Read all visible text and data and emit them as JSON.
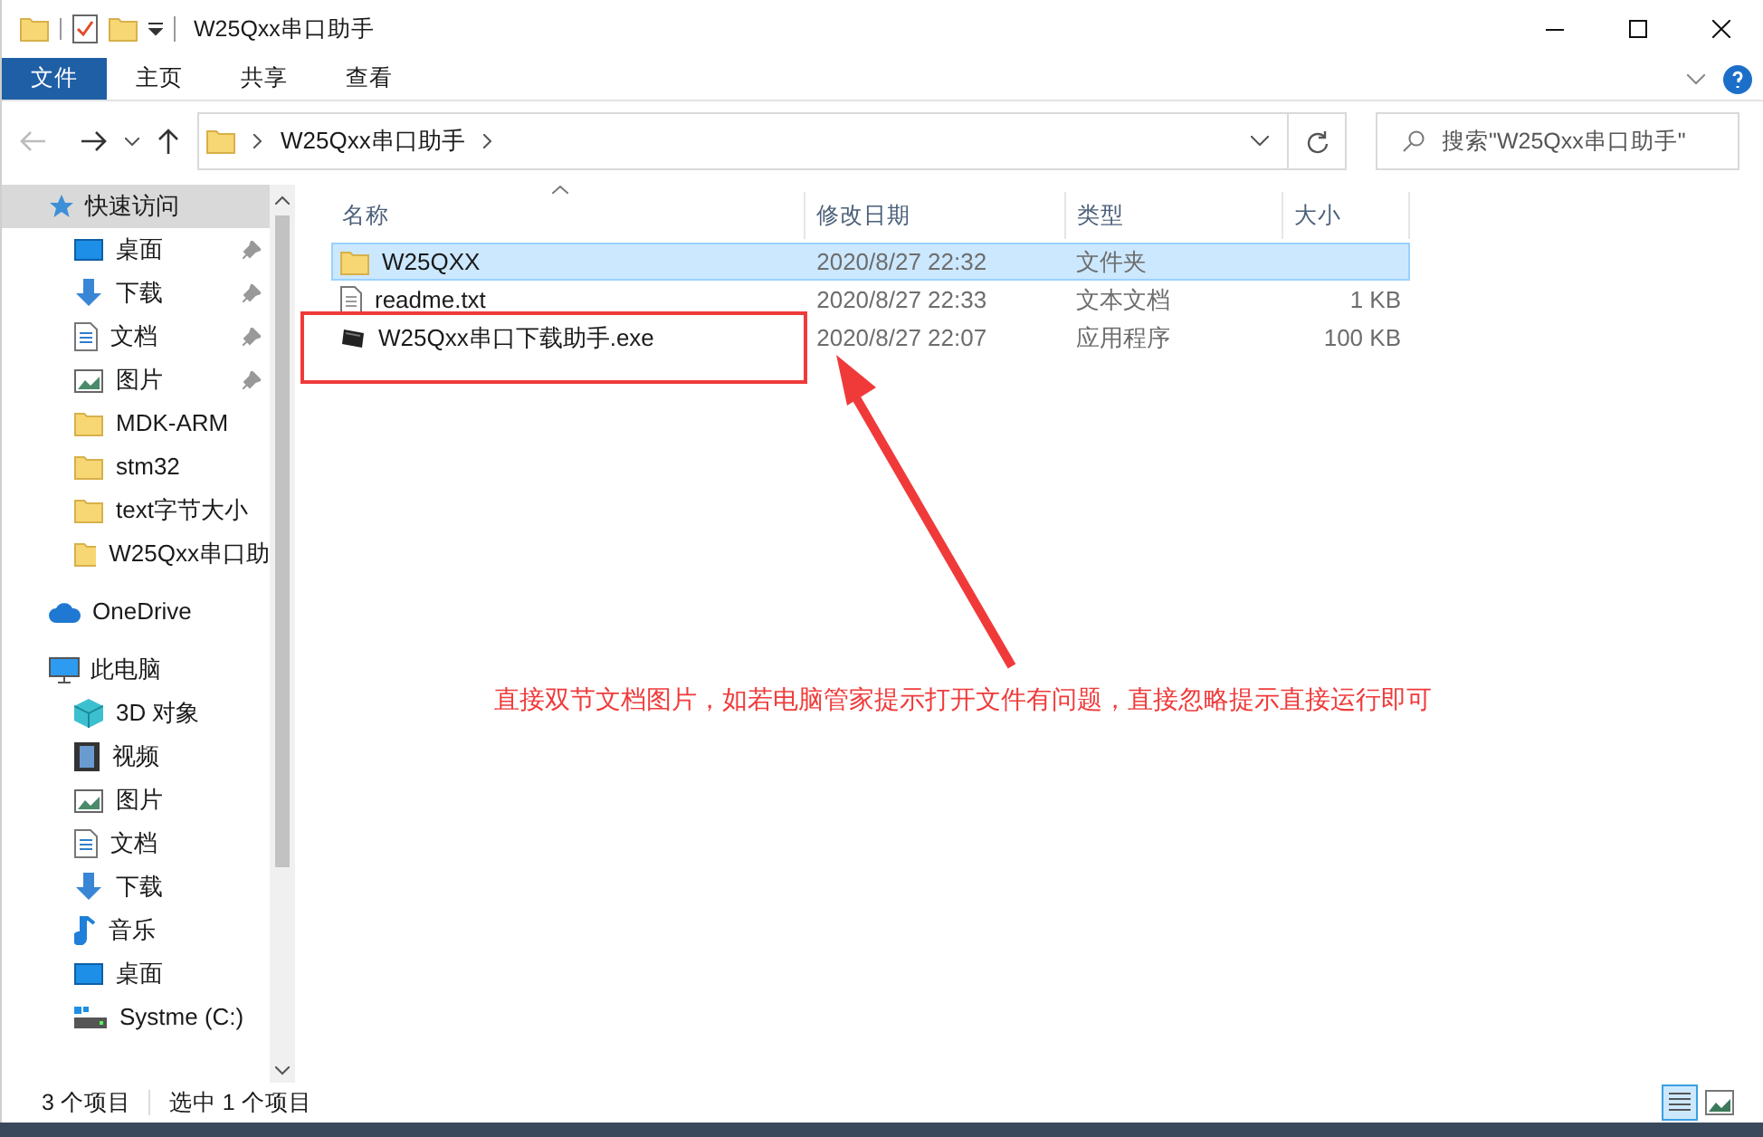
{
  "window": {
    "title": "W25Qxx串口助手"
  },
  "ribbon_tabs": [
    {
      "label": "文件",
      "selected": true
    },
    {
      "label": "主页",
      "selected": false
    },
    {
      "label": "共享",
      "selected": false
    },
    {
      "label": "查看",
      "selected": false
    }
  ],
  "address": {
    "path": [
      "W25Qxx串口助手"
    ]
  },
  "search": {
    "placeholder": "搜索\"W25Qxx串口助手\""
  },
  "sidebar": {
    "groups": [
      {
        "label": "快速访问",
        "kind": "star",
        "selected": true,
        "children": [
          {
            "label": "桌面",
            "kind": "desktop",
            "pinned": true
          },
          {
            "label": "下载",
            "kind": "download",
            "pinned": true
          },
          {
            "label": "文档",
            "kind": "document",
            "pinned": true
          },
          {
            "label": "图片",
            "kind": "picture",
            "pinned": true
          },
          {
            "label": "MDK-ARM",
            "kind": "folder",
            "pinned": false
          },
          {
            "label": "stm32",
            "kind": "folder",
            "pinned": false
          },
          {
            "label": "text字节大小",
            "kind": "folder",
            "pinned": false
          },
          {
            "label": "W25Qxx串口助",
            "kind": "folder",
            "pinned": false
          }
        ]
      },
      {
        "label": "OneDrive",
        "kind": "cloud",
        "selected": false
      },
      {
        "label": "此电脑",
        "kind": "computer",
        "selected": false,
        "children": [
          {
            "label": "3D 对象",
            "kind": "cube",
            "pinned": false
          },
          {
            "label": "视频",
            "kind": "video",
            "pinned": false
          },
          {
            "label": "图片",
            "kind": "picture",
            "pinned": false
          },
          {
            "label": "文档",
            "kind": "document",
            "pinned": false
          },
          {
            "label": "下载",
            "kind": "download",
            "pinned": false
          },
          {
            "label": "音乐",
            "kind": "music",
            "pinned": false
          },
          {
            "label": "桌面",
            "kind": "desktop",
            "pinned": false
          },
          {
            "label": "Systme (C:)",
            "kind": "drive",
            "pinned": false
          }
        ]
      }
    ]
  },
  "table": {
    "columns": [
      "名称",
      "修改日期",
      "类型",
      "大小"
    ],
    "rows": [
      {
        "name": "W25QXX",
        "date": "2020/8/27 22:32",
        "type": "文件夹",
        "kind": "folder",
        "selected": true
      },
      {
        "name": "readme.txt",
        "date": "2020/8/27 22:33",
        "type": "文本文档",
        "size": "1 KB",
        "kind": "text",
        "selected": false
      },
      {
        "name": "W25Qxx串口下载助手.exe",
        "date": "2020/8/27 22:07",
        "type": "应用程序",
        "size": "100 KB",
        "kind": "app",
        "selected": false
      }
    ]
  },
  "annotation": {
    "text": "直接双节文档图片，如若电脑管家提示打开文件有问题，直接忽略提示直接运行即可"
  },
  "status_bar": {
    "item_count": "3 个项目",
    "selection": "选中 1 个项目"
  }
}
